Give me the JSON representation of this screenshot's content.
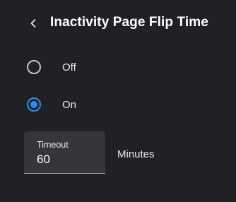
{
  "header": {
    "back_icon": "chevron-left-icon",
    "title": "Inactivity Page Flip Time"
  },
  "options": [
    {
      "label": "Off",
      "selected": false
    },
    {
      "label": "On",
      "selected": true
    }
  ],
  "timeout": {
    "label": "Timeout",
    "value": "60",
    "unit": "Minutes"
  },
  "colors": {
    "background": "#202124",
    "accent": "#2d8cf0",
    "field_background": "#35363a"
  }
}
